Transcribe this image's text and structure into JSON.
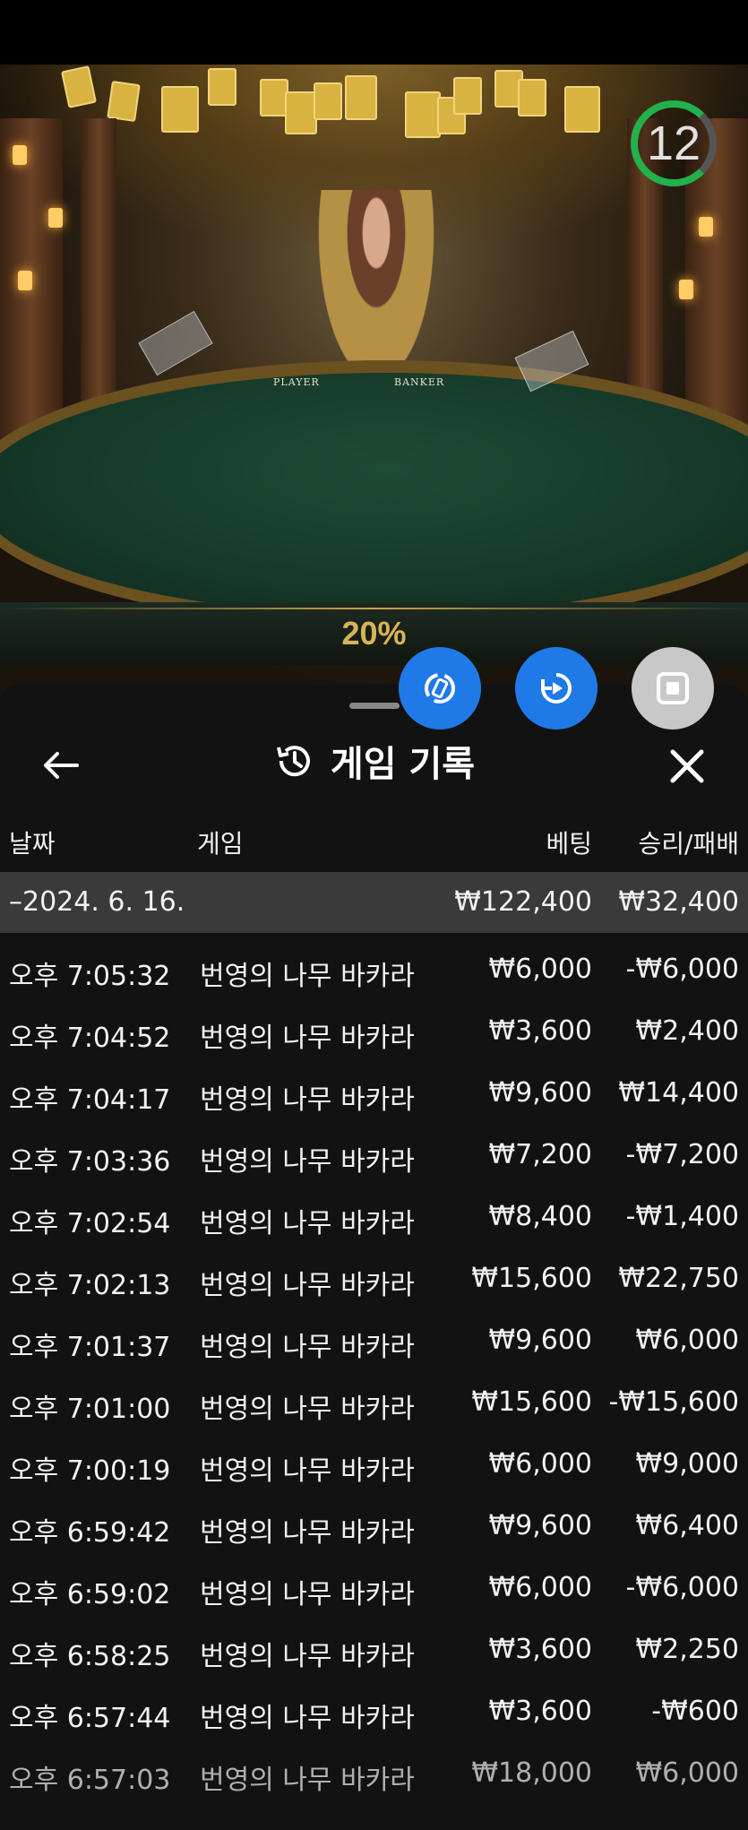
{
  "video": {
    "timer": "12",
    "table_player_label": "PLAYER",
    "table_banker_label": "BANKER",
    "progress_percent": "20%"
  },
  "controls": {
    "icons": [
      "switch-table-icon",
      "replay-icon",
      "stop-icon"
    ],
    "colors": {
      "blue": "#1f7ae8",
      "grey": "#c8c8c8",
      "timer_green": "#22b14c"
    }
  },
  "panel": {
    "title": "게임 기록",
    "columns": {
      "date": "날짜",
      "game": "게임",
      "bet": "베팅",
      "result": "승리/패배"
    },
    "summary": {
      "date": "–2024. 6. 16.",
      "bet": "₩122,400",
      "result": "₩32,400"
    },
    "rows": [
      {
        "time": "오후 7:05:32",
        "game": "번영의 나무 바카라",
        "bet": "₩6,000",
        "result": "-₩6,000"
      },
      {
        "time": "오후 7:04:52",
        "game": "번영의 나무 바카라",
        "bet": "₩3,600",
        "result": "₩2,400"
      },
      {
        "time": "오후 7:04:17",
        "game": "번영의 나무 바카라",
        "bet": "₩9,600",
        "result": "₩14,400"
      },
      {
        "time": "오후 7:03:36",
        "game": "번영의 나무 바카라",
        "bet": "₩7,200",
        "result": "-₩7,200"
      },
      {
        "time": "오후 7:02:54",
        "game": "번영의 나무 바카라",
        "bet": "₩8,400",
        "result": "-₩1,400"
      },
      {
        "time": "오후 7:02:13",
        "game": "번영의 나무 바카라",
        "bet": "₩15,600",
        "result": "₩22,750"
      },
      {
        "time": "오후 7:01:37",
        "game": "번영의 나무 바카라",
        "bet": "₩9,600",
        "result": "₩6,000"
      },
      {
        "time": "오후 7:01:00",
        "game": "번영의 나무 바카라",
        "bet": "₩15,600",
        "result": "-₩15,600"
      },
      {
        "time": "오후 7:00:19",
        "game": "번영의 나무 바카라",
        "bet": "₩6,000",
        "result": "₩9,000"
      },
      {
        "time": "오후 6:59:42",
        "game": "번영의 나무 바카라",
        "bet": "₩9,600",
        "result": "₩6,400"
      },
      {
        "time": "오후 6:59:02",
        "game": "번영의 나무 바카라",
        "bet": "₩6,000",
        "result": "-₩6,000"
      },
      {
        "time": "오후 6:58:25",
        "game": "번영의 나무 바카라",
        "bet": "₩3,600",
        "result": "₩2,250"
      },
      {
        "time": "오후 6:57:44",
        "game": "번영의 나무 바카라",
        "bet": "₩3,600",
        "result": "-₩600"
      },
      {
        "time": "오후 6:57:03",
        "game": "번영의 나무 바카라",
        "bet": "₩18,000",
        "result": "₩6,000"
      }
    ]
  }
}
